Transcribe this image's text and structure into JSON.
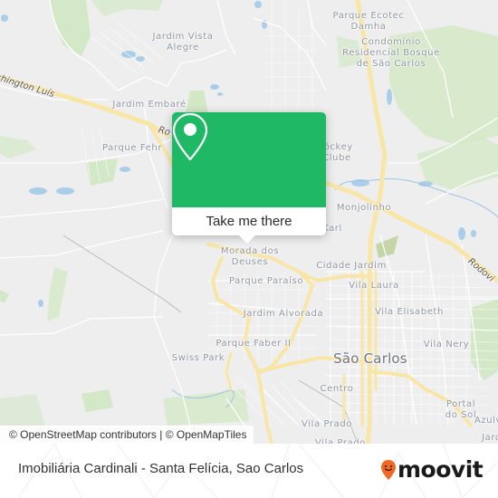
{
  "map": {
    "colors": {
      "background": "#eeeeef",
      "park": "#d3e8c6",
      "water": "#aacde8",
      "major_road": "#f8e6a6",
      "minor_road": "#ffffff",
      "label": "#8f959d"
    },
    "place_labels": [
      {
        "id": "jardim-vista-alegre",
        "text": "Jardim Vista\nAlegre"
      },
      {
        "id": "parque-ecotec-damha",
        "text": "Parque Ecotec\nDamha"
      },
      {
        "id": "condominio-bosque",
        "text": "Condomínio\nResidencial Bosque\nde São Carlos"
      },
      {
        "id": "jardim-embare",
        "text": "Jardim Embaré"
      },
      {
        "id": "parque-fehr",
        "text": "Parque Fehr"
      },
      {
        "id": "jockey-clube",
        "text": "Jóckey\nClube"
      },
      {
        "id": "monjolinho",
        "text": "Monjolinho"
      },
      {
        "id": "tijuco-karl",
        "text": "Karl"
      },
      {
        "id": "morada-dos-deuses",
        "text": "Morada dos\nDeuses"
      },
      {
        "id": "cidade-jardim",
        "text": "Cidade Jardim"
      },
      {
        "id": "parque-paraiso",
        "text": "Parque Paraíso"
      },
      {
        "id": "vila-laura",
        "text": "Vila Laura"
      },
      {
        "id": "jardim-alvorada",
        "text": "Jardim Alvorada"
      },
      {
        "id": "vila-elisabeth",
        "text": "Vila Elisabeth"
      },
      {
        "id": "vila-nery",
        "text": "Vila Nery"
      },
      {
        "id": "parque-faber-ii",
        "text": "Parque Faber II"
      },
      {
        "id": "swiss-park",
        "text": "Swiss Park"
      },
      {
        "id": "sao-carlos",
        "text": "São Carlos"
      },
      {
        "id": "centro",
        "text": "Centro"
      },
      {
        "id": "portal-do-sol",
        "text": "Portal do Sol"
      },
      {
        "id": "azulville",
        "text": "Azulv"
      },
      {
        "id": "vila-prado",
        "text": "Vila Prado"
      },
      {
        "id": "vila-prado-2",
        "text": "Vila Prado"
      },
      {
        "id": "jardim-se",
        "text": "Jard"
      }
    ],
    "road_labels": [
      {
        "id": "washington-luis",
        "text": "shington Luís"
      },
      {
        "id": "rodovia-west",
        "text": "Ro"
      },
      {
        "id": "rodovia-east",
        "text": "Rodovi"
      }
    ]
  },
  "popup": {
    "icon": "map-pin-icon",
    "button_label": "Take me there",
    "color": "#1fb865"
  },
  "attribution": {
    "osm": "© OpenStreetMap contributors",
    "separator": " | ",
    "omt": "© OpenMapTiles"
  },
  "footer": {
    "title": "Imobiliária Cardinali - Santa Felícia, Sao Carlos",
    "brand": "moovit",
    "brand_icon": "moovit-pin-smile-icon",
    "brand_color": "#f26722"
  }
}
